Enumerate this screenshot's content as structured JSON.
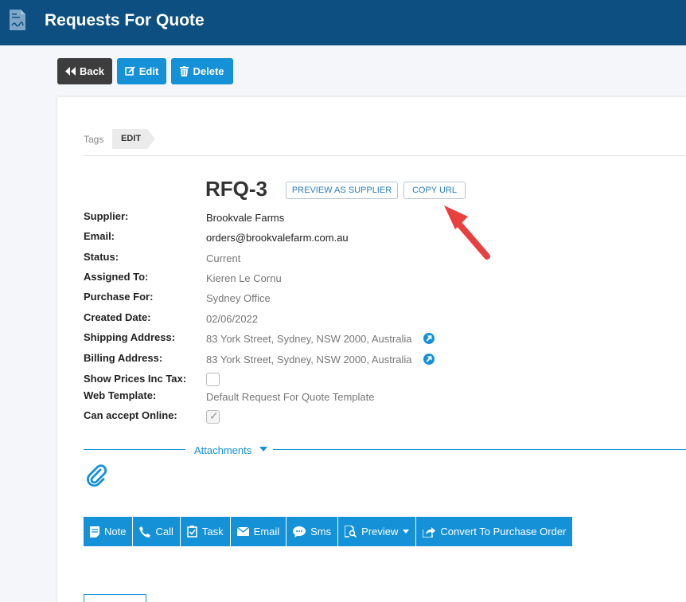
{
  "header": {
    "title": "Requests For Quote",
    "icon": "document-icon"
  },
  "toolbar": {
    "back_label": "Back",
    "edit_label": "Edit",
    "delete_label": "Delete"
  },
  "tags": {
    "label": "Tags",
    "edit_tag": "EDIT"
  },
  "record": {
    "title": "RFQ-3",
    "preview_as_supplier": "PREVIEW AS SUPPLIER",
    "copy_url": "COPY URL",
    "fields": {
      "supplier_label": "Supplier:",
      "supplier": "Brookvale Farms",
      "email_label": "Email:",
      "email": "orders@brookvalefarm.com.au",
      "status_label": "Status:",
      "status": "Current",
      "assigned_label": "Assigned To:",
      "assigned": "Kieren Le Cornu",
      "purchase_for_label": "Purchase For:",
      "purchase_for": "Sydney Office",
      "created_label": "Created Date:",
      "created": "02/06/2022",
      "shipping_label": "Shipping Address:",
      "shipping": "83 York Street, Sydney, NSW 2000, Australia",
      "billing_label": "Billing Address:",
      "billing": "83 York Street, Sydney, NSW 2000, Australia",
      "prices_inc_tax_label": "Show Prices Inc Tax:",
      "prices_inc_tax": false,
      "web_template_label": "Web Template:",
      "web_template": "Default Request For Quote Template",
      "accept_online_label": "Can accept Online:",
      "accept_online": true
    }
  },
  "attachments": {
    "label": "Attachments"
  },
  "actions": {
    "note": "Note",
    "call": "Call",
    "task": "Task",
    "email": "Email",
    "sms": "Sms",
    "preview": "Preview",
    "convert": "Convert To Purchase Order"
  },
  "colors": {
    "header": "#0c4f80",
    "accent": "#1591d8",
    "back_button": "#3d3d3d",
    "arrow": "#e8403f"
  }
}
